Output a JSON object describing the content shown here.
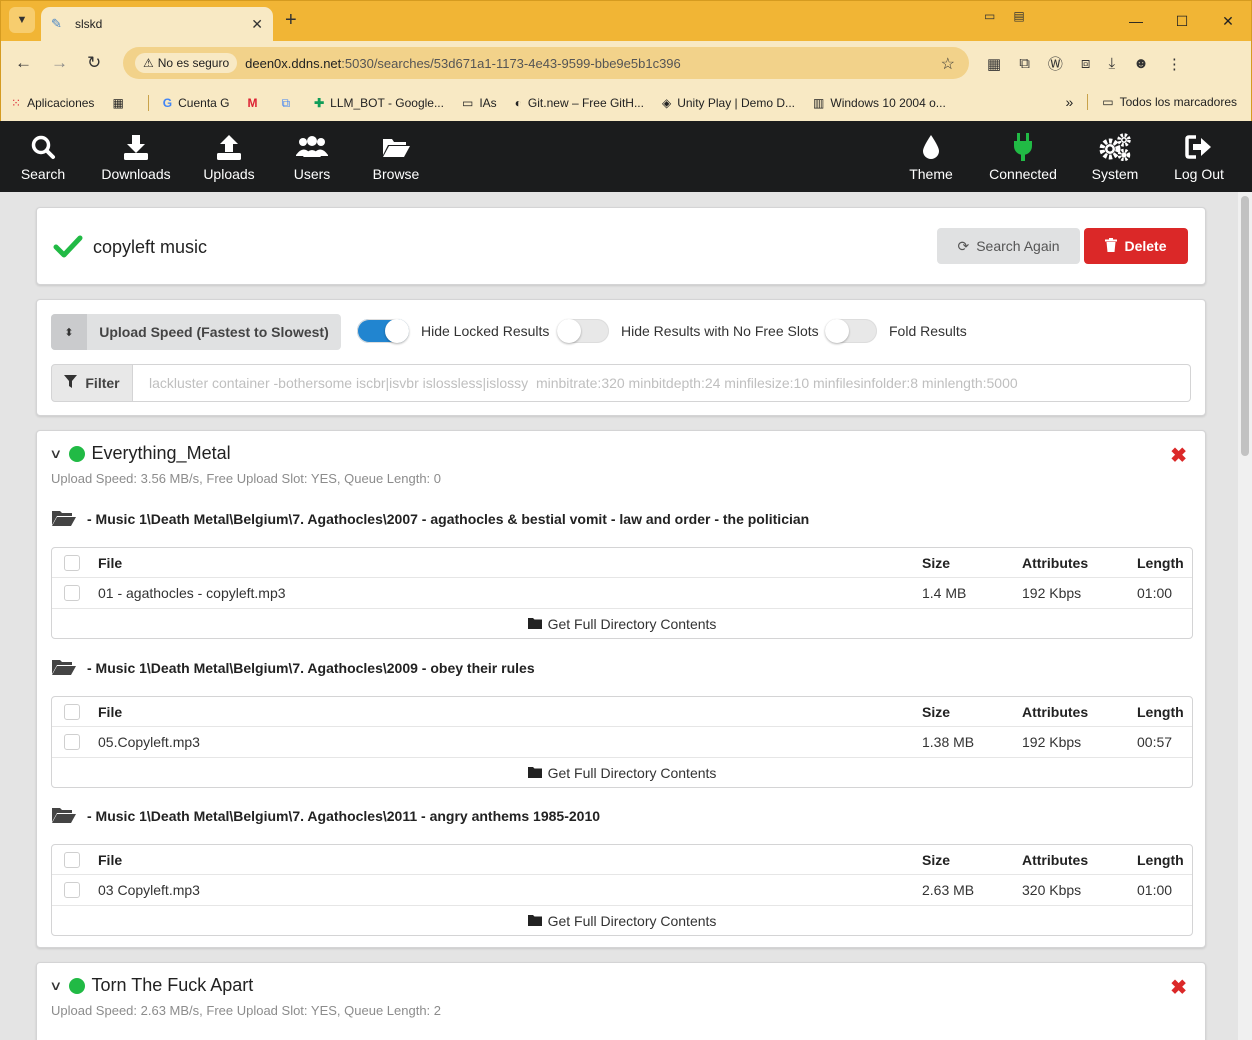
{
  "browser": {
    "tab_title": "slskd",
    "insecure_label": "No es seguro",
    "url_host": "deen0x.ddns.net",
    "url_path": ":5030/searches/53d671a1-1173-4e43-9599-bbe9e5b1c396",
    "bookmarks": [
      {
        "label": "Aplicaciones",
        "icon": "apps-grid-icon"
      },
      {
        "label": "Cuenta G",
        "icon": "google-icon"
      },
      {
        "label": "LLM_BOT - Google...",
        "icon": "sheets-icon"
      },
      {
        "label": "IAs",
        "icon": "folder-icon"
      },
      {
        "label": "Git.new – Free GitH...",
        "icon": "gitnew-icon"
      },
      {
        "label": "Unity Play | Demo D...",
        "icon": "unity-icon"
      },
      {
        "label": "Windows 10 2004 o...",
        "icon": "archive-icon"
      }
    ],
    "all_bookmarks": "Todos los marcadores"
  },
  "nav": {
    "search": "Search",
    "downloads": "Downloads",
    "uploads": "Uploads",
    "users": "Users",
    "browse": "Browse",
    "theme": "Theme",
    "connected": "Connected",
    "system": "System",
    "logout": "Log Out",
    "connected_color": "#21ba45"
  },
  "search": {
    "query": "copyleft music",
    "search_again": "Search Again",
    "delete": "Delete"
  },
  "options": {
    "sort": "Upload Speed (Fastest to Slowest)",
    "hide_locked": "Hide Locked Results",
    "hide_locked_on": true,
    "hide_no_slots": "Hide Results with No Free Slots",
    "hide_no_slots_on": false,
    "fold": "Fold Results",
    "fold_on": false,
    "filter_label": "Filter",
    "filter_placeholder": "lackluster container -bothersome iscbr|isvbr islossless|islossy  minbitrate:320 minbitdepth:24 minfilesize:10 minfilesinfolder:8 minlength:5000"
  },
  "table_headers": {
    "file": "File",
    "size": "Size",
    "attributes": "Attributes",
    "length": "Length"
  },
  "get_full": "Get Full Directory Contents",
  "results": [
    {
      "user": "Everything_Metal",
      "info": "Upload Speed: 3.56 MB/s, Free Upload Slot: YES, Queue Length: 0",
      "directories": [
        {
          "path": "- Music 1\\Death Metal\\Belgium\\7. Agathocles\\2007 - agathocles & bestial vomit - law and order - the politician",
          "files": [
            {
              "name": "01 - agathocles - copyleft.mp3",
              "size": "1.4 MB",
              "attributes": "192 Kbps",
              "length": "01:00"
            }
          ]
        },
        {
          "path": "- Music 1\\Death Metal\\Belgium\\7. Agathocles\\2009 - obey their rules",
          "files": [
            {
              "name": "05.Copyleft.mp3",
              "size": "1.38 MB",
              "attributes": "192 Kbps",
              "length": "00:57"
            }
          ]
        },
        {
          "path": "- Music 1\\Death Metal\\Belgium\\7. Agathocles\\2011 - angry anthems 1985-2010",
          "files": [
            {
              "name": "03 Copyleft.mp3",
              "size": "2.63 MB",
              "attributes": "320 Kbps",
              "length": "01:00"
            }
          ]
        }
      ]
    },
    {
      "user": "Torn The Fuck Apart",
      "info": "Upload Speed: 2.63 MB/s, Free Upload Slot: YES, Queue Length: 2",
      "directories": []
    }
  ]
}
